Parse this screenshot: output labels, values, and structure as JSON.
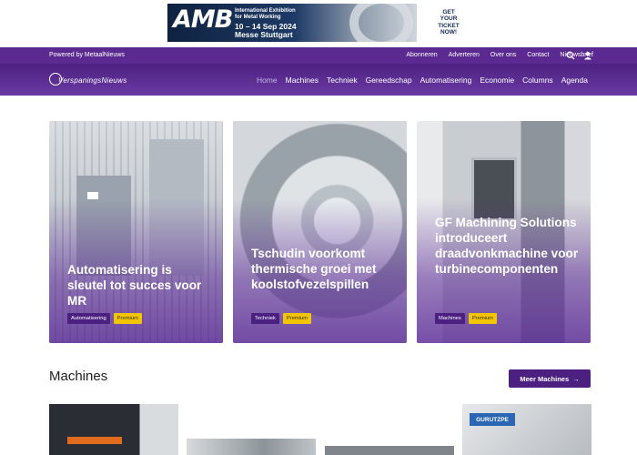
{
  "ad": {
    "logo": "AMB",
    "line1": "International Exhibition",
    "line2": "for Metal Working",
    "date": "10 – 14 Sep 2024",
    "venue": "Messe Stuttgart",
    "cta_line1": "GET",
    "cta_line2": "YOUR",
    "cta_line3": "TICKET",
    "cta_line4": "NOW!"
  },
  "topbar": {
    "powered": "Powered by MetaalNieuws",
    "links": [
      "Abonneren",
      "Adverteren",
      "Over ons",
      "Contact",
      "Nieuwsbrief"
    ]
  },
  "nav": {
    "logo": "VerspaningsNieuws",
    "items": [
      "Home",
      "Machines",
      "Techniek",
      "Gereedschap",
      "Automatisering",
      "Economie",
      "Columns",
      "Agenda"
    ]
  },
  "cards": [
    {
      "title": "Automatisering is sleutel tot succes voor MR",
      "category": "Automatisering",
      "premium": "Premium"
    },
    {
      "title": "Tschudin voorkomt thermische groei met koolstofvezelspillen",
      "category": "Techniek",
      "premium": "Premium"
    },
    {
      "title": "GF Machining Solutions introduceert draadvonkmachine voor turbinecomponenten",
      "category": "Machines",
      "premium": "Premium"
    }
  ],
  "section": {
    "title": "Machines",
    "button": "Meer Machines"
  },
  "thumbs": {
    "t4_sign": "GURUTZPE"
  },
  "colors": {
    "brand": "#5b2a90",
    "premium": "#f3c400"
  },
  "icons": [
    "search-icon",
    "user-icon",
    "arrow-right-icon"
  ]
}
